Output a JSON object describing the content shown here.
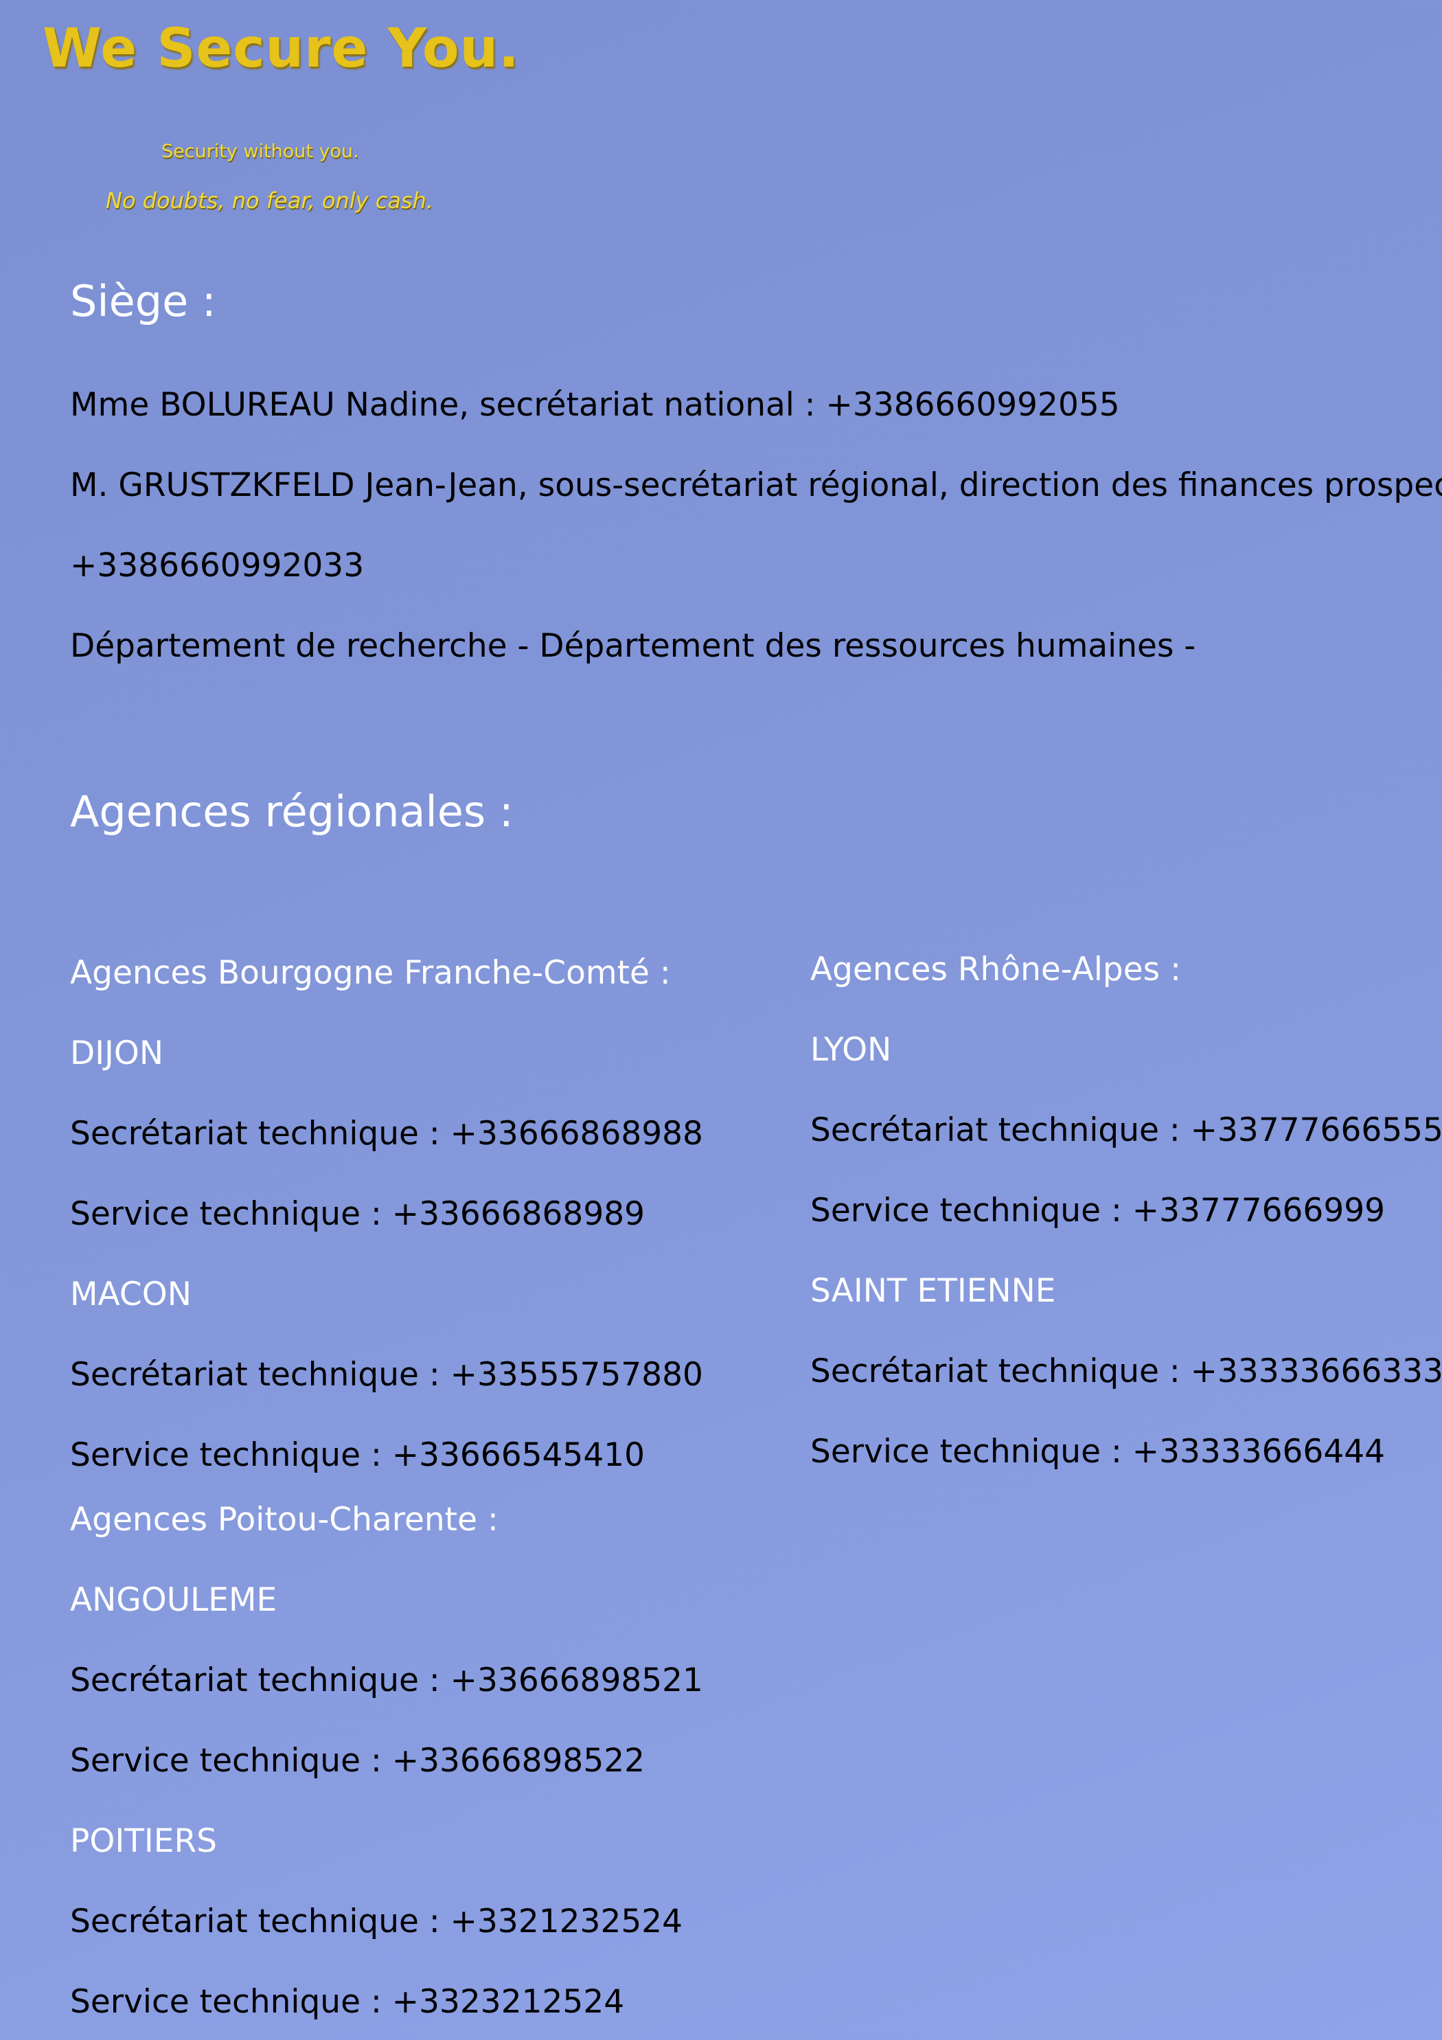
{
  "brand": {
    "title": "We Secure You.",
    "tagline_1": "Security without you.",
    "tagline_2": "No doubts, no fear, only cash."
  },
  "siege": {
    "title": "Siège :",
    "lines": [
      "Mme BOLUREAU Nadine, secrétariat national : +3386660992055",
      "M. GRUSTZKFELD Jean-Jean, sous-secrétariat régional, direction des finances prospect :",
      "+3386660992033",
      "Département de recherche - Département des ressources humaines -"
    ]
  },
  "agences": {
    "title": "Agences régionales :",
    "bourgogne": {
      "region": "Agences Bourgogne Franche-Comté :",
      "dijon": {
        "city": "DIJON",
        "secretariat": "Secrétariat technique : +33666868988",
        "service": "Service technique : +33666868989"
      },
      "macon": {
        "city": "MACON",
        "secretariat": "Secrétariat technique : +33555757880",
        "service": "Service technique : +33666545410"
      }
    },
    "poitou": {
      "region": "Agences Poitou-Charente :",
      "angouleme": {
        "city": "ANGOULEME",
        "secretariat": "Secrétariat technique : +33666898521",
        "service": "Service technique : +33666898522"
      },
      "poitiers": {
        "city": "POITIERS",
        "secretariat": "Secrétariat technique : +3321232524",
        "service": "Service technique : +3323212524"
      }
    },
    "rhone": {
      "region": "Agences Rhône-Alpes :",
      "lyon": {
        "city": "LYON",
        "secretariat": "Secrétariat technique : +33777666555",
        "service": "Service technique : +33777666999"
      },
      "saint_etienne": {
        "city": "SAINT ETIENNE",
        "secretariat": "Secrétariat technique : +33333666333",
        "service": "Service technique : +33333666444"
      }
    }
  }
}
